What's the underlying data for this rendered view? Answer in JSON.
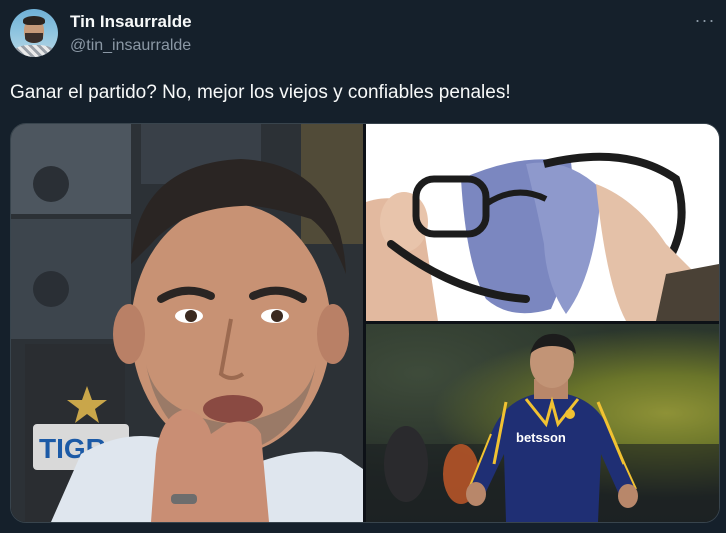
{
  "author": {
    "name": "Tin Insaurralde",
    "handle": "@tin_insaurralde"
  },
  "menu": {
    "more_label": "···"
  },
  "tweet": {
    "text": "Ganar el partido? No, mejor los viejos y confiables penales!"
  },
  "media": {
    "left_image_sign_text": "TIGR",
    "bottom_image_sponsor_text": "betsson"
  },
  "colors": {
    "background": "#15202b",
    "primary_text": "#f7f9f9",
    "secondary_text": "#8b98a5",
    "jersey_blue": "#1f2f74",
    "jersey_yellow": "#f1c232"
  }
}
